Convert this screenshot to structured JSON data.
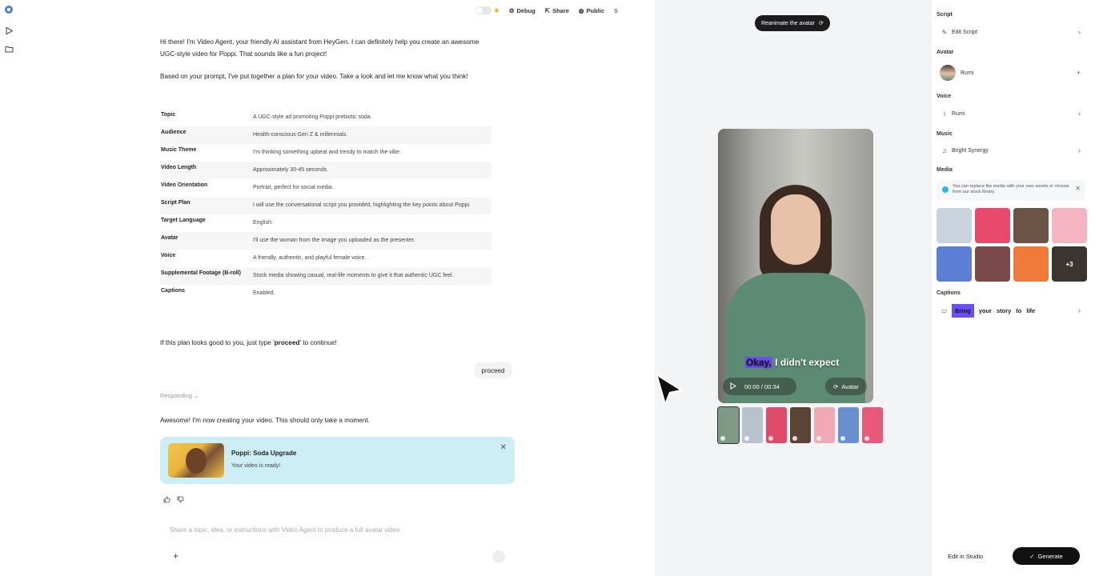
{
  "topbar": {
    "debug_label": "Debug",
    "share_label": "Share",
    "public_label": "Public",
    "user_initial": "S"
  },
  "chat": {
    "intro": "Hi there! I'm Video Agent, your friendly AI assistant from HeyGen. I can definitely help you create an awesome UGC-style video for Poppi. That sounds like a fun project!",
    "plan_intro": "Based on your prompt, I've put together a plan for your video. Take a look and let me know what you think!",
    "plan": [
      {
        "label": "Topic",
        "value": "A UGC-style ad promoting Poppi prebiotic soda."
      },
      {
        "label": "Audience",
        "value": "Health-conscious Gen Z & millennials."
      },
      {
        "label": "Music Theme",
        "value": "I'm thinking something upbeat and trendy to match the vibe."
      },
      {
        "label": "Video Length",
        "value": "Approximately 30-45 seconds."
      },
      {
        "label": "Video Orientation",
        "value": "Portrait, perfect for social media."
      },
      {
        "label": "Script Plan",
        "value": "I will use the conversational script you provided, highlighting the key points about Poppi."
      },
      {
        "label": "Target Language",
        "value": "English."
      },
      {
        "label": "Avatar",
        "value": "I'll use the woman from the image you uploaded as the presenter."
      },
      {
        "label": "Voice",
        "value": "A friendly, authentic, and playful female voice."
      },
      {
        "label": "Supplemental Footage (B-roll)",
        "value": "Stock media showing casual, real-life moments to give it that authentic UGC feel."
      },
      {
        "label": "Captions",
        "value": "Enabled."
      }
    ],
    "proceed_prompt_prefix": "If this plan looks good to you, just type '",
    "proceed_prompt_keyword": "proceed",
    "proceed_prompt_suffix": "' to continue!",
    "user_reply": "proceed",
    "responding_label": "Responding",
    "creating_msg": "Awesome! I'm now creating your video. This should only take a moment.",
    "video_card": {
      "title": "Poppi: Soda Upgrade",
      "subtitle": "Your video is ready!"
    },
    "composer_placeholder": "Share a topic, idea, or instructions with Video Agent to produce a full avatar video"
  },
  "preview": {
    "reanimate_label": "Reanimate the avatar",
    "caption_highlight": "Okay,",
    "caption_rest": " I didn't expect",
    "time": "00:00 / 00:34",
    "avatar_button": "Avatar",
    "filmstrip_colors": [
      "#7c9a86",
      "#b8c2cc",
      "#e14b6b",
      "#5b4436",
      "#f2a9b6",
      "#6a8fd1",
      "#e75a7a"
    ]
  },
  "panel": {
    "script_label": "Script",
    "edit_script": "Edit Script",
    "avatar_label": "Avatar",
    "avatar_name": "Rumi",
    "voice_label": "Voice",
    "voice_name": "Rumi",
    "music_label": "Music",
    "music_name": "Bright Synergy",
    "media_label": "Media",
    "media_note": "You can replace the media with your own assets or choose from our stock library.",
    "media_more": "+3",
    "media_colors": [
      "#c9d4de",
      "#e84a6e",
      "#6b5446",
      "#f4b4c2",
      "#5b7fd4",
      "#7a4a4a",
      "#f07a3a",
      "#3a3530"
    ],
    "captions_label": "Captions",
    "caption_words": [
      "Bring",
      "your",
      "story",
      "to",
      "life"
    ],
    "edit_in_studio": "Edit in Studio",
    "generate": "Generate"
  }
}
